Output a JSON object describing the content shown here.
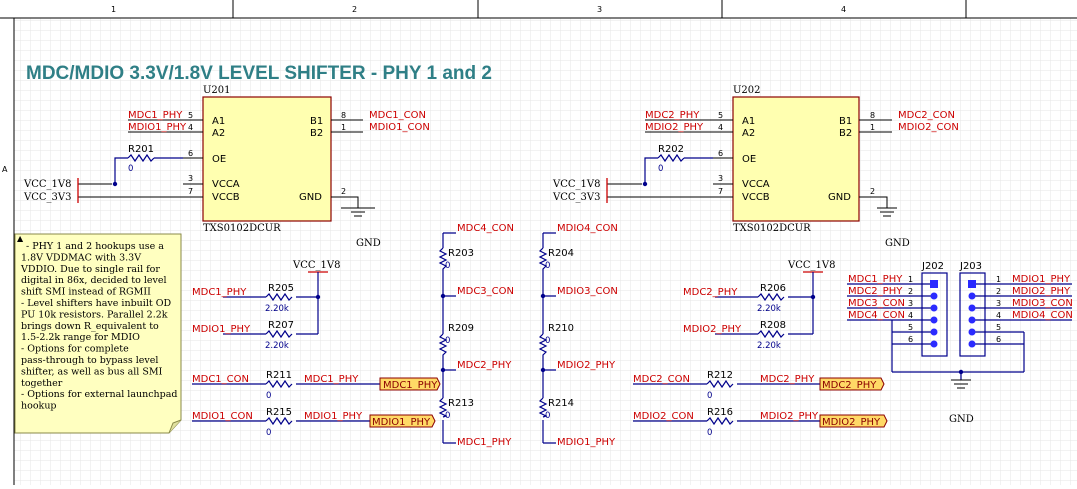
{
  "frame": {
    "zones": [
      "1",
      "2",
      "3",
      "4"
    ],
    "row_label": "A"
  },
  "title": "MDC/MDIO 3.3V/1.8V LEVEL SHIFTER - PHY 1 and 2",
  "u201": {
    "ref": "U201",
    "part": "TXS0102DCUR",
    "pins": {
      "a1": "A1",
      "a2": "A2",
      "oe": "OE",
      "vcca": "VCCA",
      "vccb": "VCCB",
      "b1": "B1",
      "b2": "B2",
      "gnd": "GND"
    },
    "pin_nums": {
      "a1": "5",
      "a2": "4",
      "oe": "6",
      "vcca": "3",
      "vccb": "7",
      "b1": "8",
      "b2": "1",
      "gnd": "2"
    },
    "nets": {
      "a1": "MDC1_PHY",
      "a2": "MDIO1_PHY",
      "b1": "MDC1_CON",
      "b2": "MDIO1_CON",
      "vcca": "VCC_1V8",
      "vccb": "VCC_3V3"
    },
    "oe_res": {
      "ref": "R201",
      "value": "0"
    },
    "gnd_label": "GND"
  },
  "u202": {
    "ref": "U202",
    "part": "TXS0102DCUR",
    "pins": {
      "a1": "A1",
      "a2": "A2",
      "oe": "OE",
      "vcca": "VCCA",
      "vccb": "VCCB",
      "b1": "B1",
      "b2": "B2",
      "gnd": "GND"
    },
    "pin_nums": {
      "a1": "5",
      "a2": "4",
      "oe": "6",
      "vcca": "3",
      "vccb": "7",
      "b1": "8",
      "b2": "1",
      "gnd": "2"
    },
    "nets": {
      "a1": "MDC2_PHY",
      "a2": "MDIO2_PHY",
      "b1": "MDC2_CON",
      "b2": "MDIO2_CON",
      "vcca": "VCC_1V8",
      "vccb": "VCC_3V3"
    },
    "oe_res": {
      "ref": "R202",
      "value": "0"
    },
    "gnd_label": "GND"
  },
  "note": {
    "lines": [
      "- PHY 1 and 2 hookups use a",
      "1.8V VDDMAC with 3.3V",
      "VDDIO. Due to single rail for",
      "digital in 86x, decided to level",
      "shift SMI instead of RGMII",
      "- Level shifters have inbuilt OD",
      "PU 10k resistors. Parallel 2.2k",
      "brings down R_equivalent to",
      "1.5-2.2k range for MDIO",
      "- Options for complete",
      "pass-through to bypass level",
      "shifter, as well as bus all SMI",
      "together",
      "- Options for external launchpad",
      "hookup"
    ]
  },
  "pullups_left": {
    "rail": "VCC_1V8",
    "r1": {
      "ref": "R205",
      "value": "2.20k",
      "net": "MDC1_PHY"
    },
    "r2": {
      "ref": "R207",
      "value": "2.20k",
      "net": "MDIO1_PHY"
    }
  },
  "pullups_right": {
    "rail": "VCC_1V8",
    "r1": {
      "ref": "R206",
      "value": "2.20k",
      "net": "MDC2_PHY"
    },
    "r2": {
      "ref": "R208",
      "value": "2.20k",
      "net": "MDIO2_PHY"
    }
  },
  "bypass_left": {
    "r1": {
      "ref": "R211",
      "value": "0",
      "from": "MDC1_CON",
      "to": "MDC1_PHY",
      "port": "MDC1_PHY"
    },
    "r2": {
      "ref": "R215",
      "value": "0",
      "from": "MDIO1_CON",
      "to": "MDIO1_PHY",
      "port": "MDIO1_PHY"
    }
  },
  "bypass_right": {
    "r1": {
      "ref": "R212",
      "value": "0",
      "from": "MDC2_CON",
      "to": "MDC2_PHY",
      "port": "MDC2_PHY"
    },
    "r2": {
      "ref": "R216",
      "value": "0",
      "from": "MDIO2_CON",
      "to": "MDIO2_PHY",
      "port": "MDIO2_PHY"
    }
  },
  "chain_mdc": {
    "top": "MDC4_CON",
    "r_a": "R203",
    "n1": "MDC3_CON",
    "r_b": "R209",
    "n2": "MDC2_PHY",
    "r_c": "R213",
    "bottom": "MDC1_PHY",
    "value": "0"
  },
  "chain_mdio": {
    "top": "MDIO4_CON",
    "r_a": "R204",
    "n1": "MDIO3_CON",
    "r_b": "R210",
    "n2": "MDIO2_PHY",
    "r_c": "R214",
    "bottom": "MDIO1_PHY",
    "value": "0"
  },
  "j202": {
    "ref": "J202",
    "nets": [
      "MDC1_PHY",
      "MDC2_PHY",
      "MDC3_CON",
      "MDC4_CON"
    ],
    "pins": [
      "1",
      "2",
      "3",
      "4",
      "5",
      "6"
    ]
  },
  "j203": {
    "ref": "J203",
    "nets": [
      "MDIO1_PHY",
      "MDIO2_PHY",
      "MDIO3_CON",
      "MDIO4_CON"
    ],
    "pins": [
      "1",
      "2",
      "3",
      "4",
      "5",
      "6"
    ]
  },
  "header_gnd": "GND"
}
